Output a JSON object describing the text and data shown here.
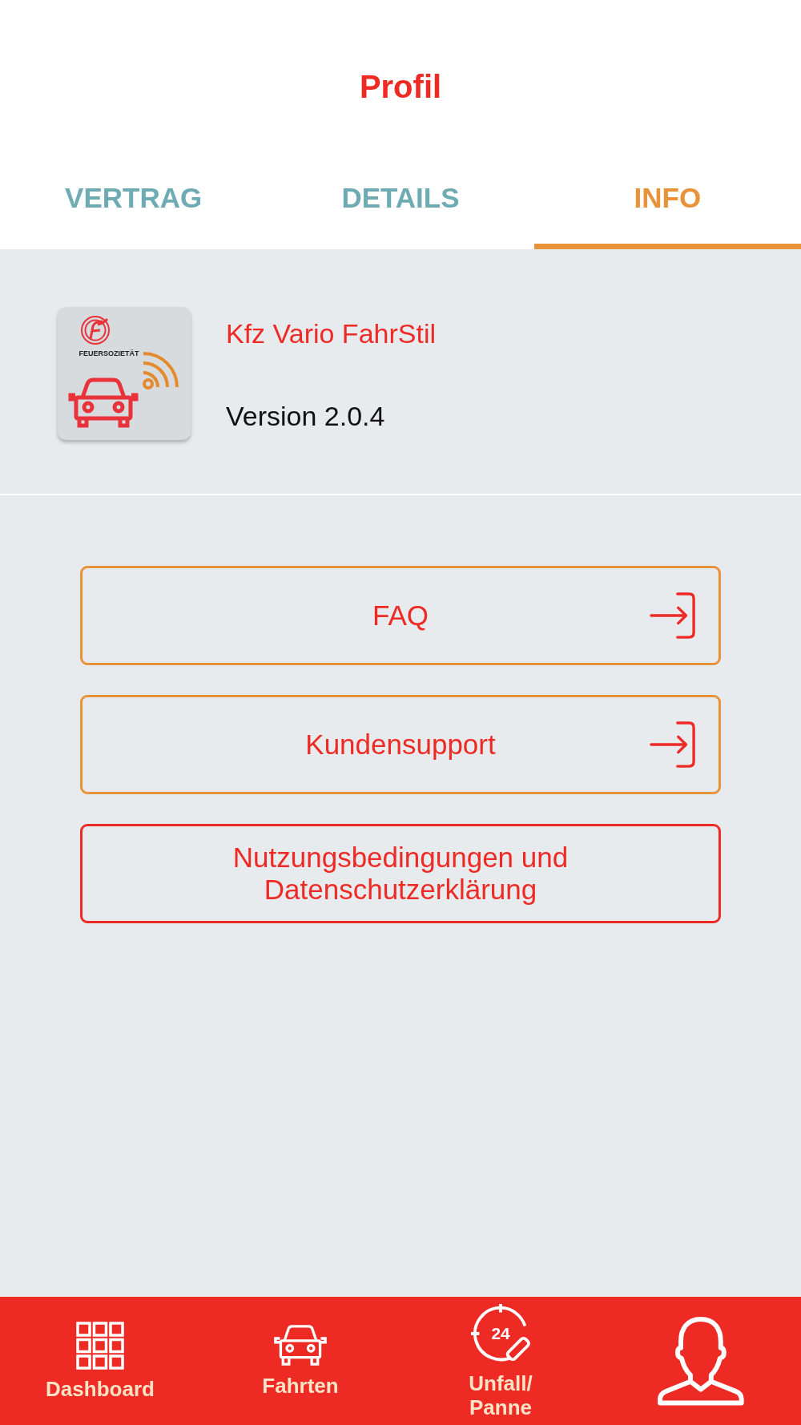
{
  "header": {
    "title": "Profil"
  },
  "tabs": [
    {
      "label": "VERTRAG",
      "selected": false
    },
    {
      "label": "DETAILS",
      "selected": false
    },
    {
      "label": "INFO",
      "selected": true
    }
  ],
  "app": {
    "icon_caption": "FEUERSOZIETÄT",
    "name": "Kfz Vario FahrStil",
    "version": "Version 2.0.4"
  },
  "links": [
    {
      "label": "FAQ",
      "kind": "external"
    },
    {
      "label": "Kundensupport",
      "kind": "external"
    },
    {
      "label": "Nutzungsbedingungen und Datenschutzerklärung",
      "kind": "plain"
    }
  ],
  "nav": [
    {
      "kind": "dashboard",
      "label": "Dashboard",
      "selected": false
    },
    {
      "kind": "trips",
      "label": "Fahrten",
      "selected": false
    },
    {
      "kind": "emergency",
      "label": "Unfall/\nPanne",
      "icon_text": "24",
      "selected": false
    },
    {
      "kind": "profile",
      "selected": true
    }
  ]
}
